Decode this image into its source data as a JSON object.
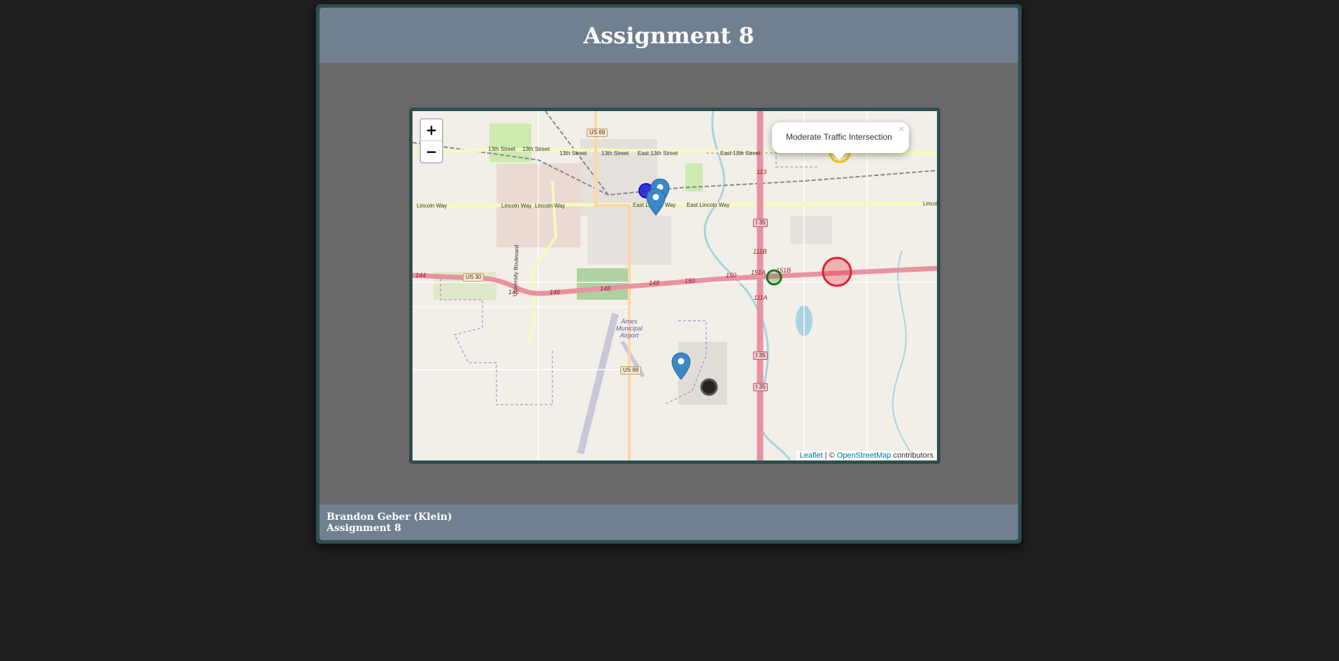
{
  "header": {
    "title": "Assignment 8"
  },
  "map": {
    "zoom_in_label": "+",
    "zoom_out_label": "−",
    "popup": {
      "text": "Moderate Traffic Intersection",
      "close": "×"
    },
    "attribution": {
      "leaflet": "Leaflet",
      "separator": " | © ",
      "osm": "OpenStreetMap",
      "suffix": " contributors"
    },
    "street_labels": {
      "thirteenth_a": "13th Street",
      "thirteenth_b": "13th Street",
      "thirteenth_c": "13th Street",
      "thirteenth_d": "13th Street",
      "thirteenth_e": "East 13th Street",
      "thirteenth_f": "East 13th Street",
      "lincoln_a": "Lincoln Way",
      "lincoln_b": "Lincoln Way",
      "lincoln_c": "Lincoln Way",
      "lincoln_d": "East Lincoln Way",
      "lincoln_e": "East Lincoln Way",
      "lincoln_f": "Lincol",
      "university": "University Boulevard",
      "airport": "Ames Municipal Airport"
    },
    "shields": {
      "us69_top": "US 69",
      "us69_bottom": "US 69",
      "us30": "US 30",
      "i35_a": "I 35",
      "i35_b": "I 35",
      "i35_c": "I 35"
    },
    "exit_labels": {
      "e144": "144",
      "e146a": "146",
      "e146b": "146",
      "e148a": "148",
      "e148b": "148",
      "e150a": "150",
      "e150b": "150",
      "e151a": "151A",
      "e151b": "151B",
      "e111b": "111B",
      "e111a": "111A",
      "e113": "113"
    },
    "markers": {
      "pin_color": "#3a88c8",
      "circle_blue": "#1515d6",
      "circle_green": "#1a7a1a",
      "circle_red": "#e02030",
      "circle_yellow": "#e8c820",
      "circle_black": "#111111"
    }
  },
  "footer": {
    "author": "Brandon Geber (Klein)",
    "assignment": "Assignment 8"
  }
}
